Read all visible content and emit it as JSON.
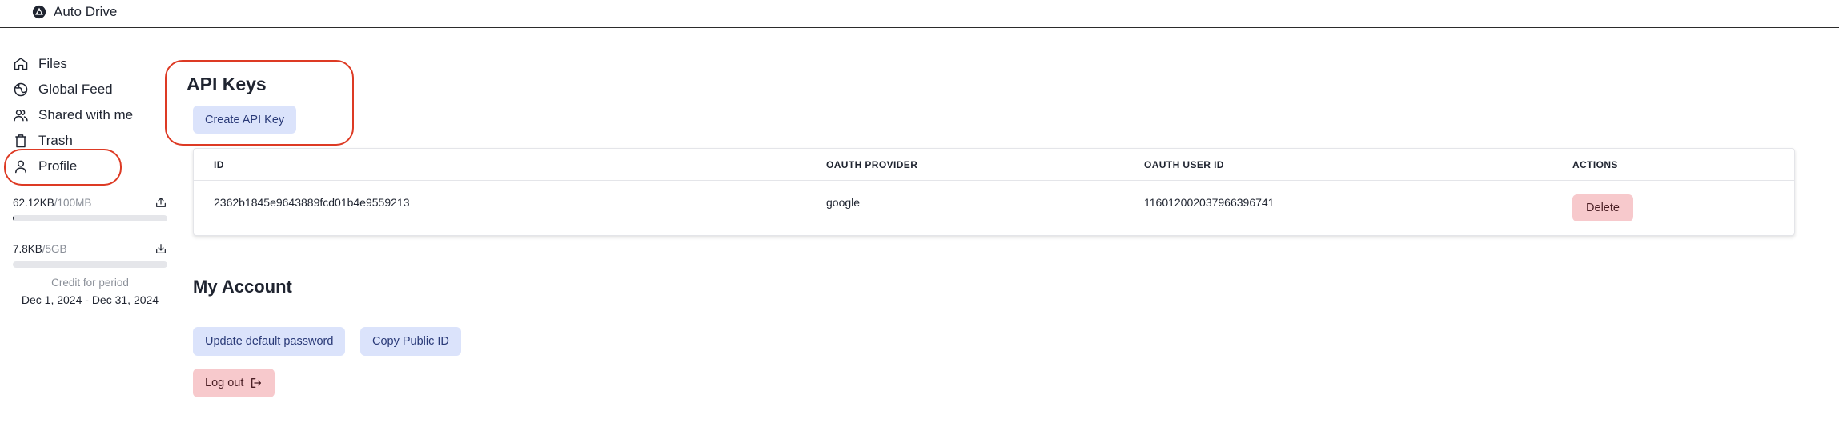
{
  "app": {
    "name": "Auto Drive",
    "logo_icon": "auto-drive-logo-icon"
  },
  "sidebar": {
    "items": [
      {
        "label": "Files",
        "icon": "home-icon"
      },
      {
        "label": "Global Feed",
        "icon": "globe-icon"
      },
      {
        "label": "Shared with me",
        "icon": "users-icon"
      },
      {
        "label": "Trash",
        "icon": "trash-icon"
      },
      {
        "label": "Profile",
        "icon": "user-icon",
        "active": true
      }
    ],
    "upload": {
      "used": "62.12KB",
      "limit": "/100MB",
      "fraction": 0.0006,
      "icon": "upload-icon"
    },
    "download": {
      "used": "7.8KB",
      "limit": "/5GB",
      "fraction": 0.0,
      "icon": "download-icon"
    },
    "credit_label": "Credit for period",
    "credit_range": "Dec 1, 2024 - Dec 31, 2024"
  },
  "api_keys": {
    "title": "API Keys",
    "create_label": "Create API Key",
    "columns": [
      "ID",
      "OAUTH PROVIDER",
      "OAUTH USER ID",
      "ACTIONS"
    ],
    "rows": [
      {
        "id": "2362b1845e9643889fcd01b4e9559213",
        "provider": "google",
        "user_id": "116012002037966396741",
        "action": "Delete"
      }
    ]
  },
  "account": {
    "title": "My Account",
    "update_password_label": "Update default password",
    "copy_id_label": "Copy Public ID",
    "logout_label": "Log out"
  },
  "colors": {
    "highlight": "#dd3a24",
    "primary_button": "#dbe3fb",
    "danger_button": "#f7c9cc"
  }
}
